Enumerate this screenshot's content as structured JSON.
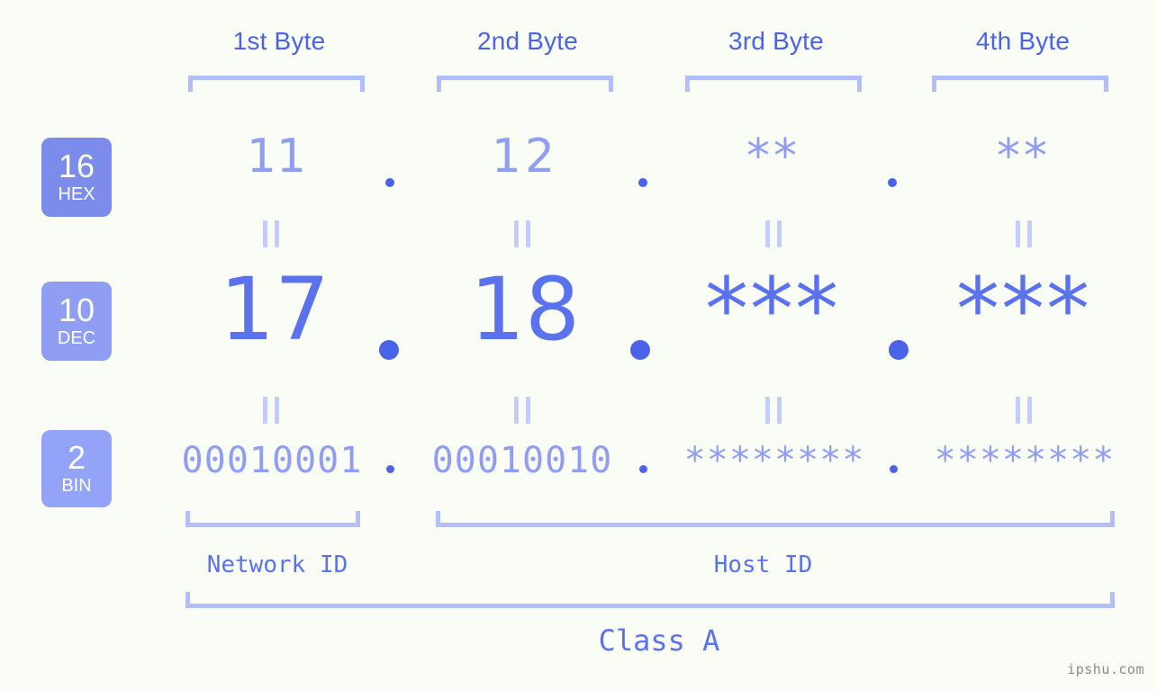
{
  "background_color": "#fafdf6",
  "accent_color": "#4a63e8",
  "muted_accent_color": "#8f9ef4",
  "bracket_color": "#b2bdfb",
  "headers": [
    {
      "label": "1st Byte"
    },
    {
      "label": "2nd Byte"
    },
    {
      "label": "3rd Byte"
    },
    {
      "label": "4th Byte"
    }
  ],
  "bases": [
    {
      "number": "16",
      "name": "HEX",
      "color": "#7b8ceb"
    },
    {
      "number": "10",
      "name": "DEC",
      "color": "#8f9ef2"
    },
    {
      "number": "2",
      "name": "BIN",
      "color": "#93a3f7"
    }
  ],
  "rows": {
    "hex": {
      "values": [
        "11",
        "12",
        "**",
        "**"
      ]
    },
    "dec": {
      "values": [
        "17",
        "18",
        "***",
        "***"
      ]
    },
    "bin": {
      "values": [
        "00010001",
        "00010010",
        "********",
        "********"
      ]
    }
  },
  "separator": ".",
  "equality_mark": "||",
  "segments": [
    {
      "label": "Network ID"
    },
    {
      "label": "Host ID"
    }
  ],
  "class_label": "Class A",
  "watermark": "ipshu.com"
}
